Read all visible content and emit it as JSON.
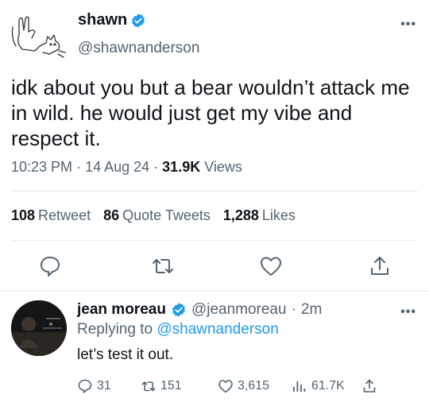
{
  "tweet": {
    "author": {
      "name": "shawn",
      "handle": "@shawnanderson",
      "avatar_icon": "hand-drawn-sketch-avatar",
      "verified": true
    },
    "text": "idk about you but a bear wouldn’t attack me in wild. he would just get my vibe and respect it.",
    "time": "10:23 PM",
    "date": "14 Aug 24",
    "views_count": "31.9K",
    "views_label": "Views",
    "stats": {
      "retweets_count": "108",
      "retweets_label": "Retweet",
      "quotes_count": "86",
      "quotes_label": "Quote Tweets",
      "likes_count": "1,288",
      "likes_label": "Likes"
    },
    "actions": [
      "reply-icon",
      "retweet-icon",
      "like-icon",
      "share-icon"
    ]
  },
  "reply": {
    "author": {
      "name": "jean moreau",
      "handle": "@jeanmoreau",
      "time": "2m",
      "verified": true
    },
    "replying_prefix": "Replying to",
    "replying_to": "@shawnanderson",
    "text": "let’s test it out.",
    "counts": {
      "replies": "31",
      "retweets": "151",
      "likes": "3,615",
      "views": "61.7K"
    }
  },
  "colors": {
    "accent": "#1d9bf0",
    "text": "#0f1419",
    "muted": "#536471",
    "divider": "#e6e9eb"
  }
}
